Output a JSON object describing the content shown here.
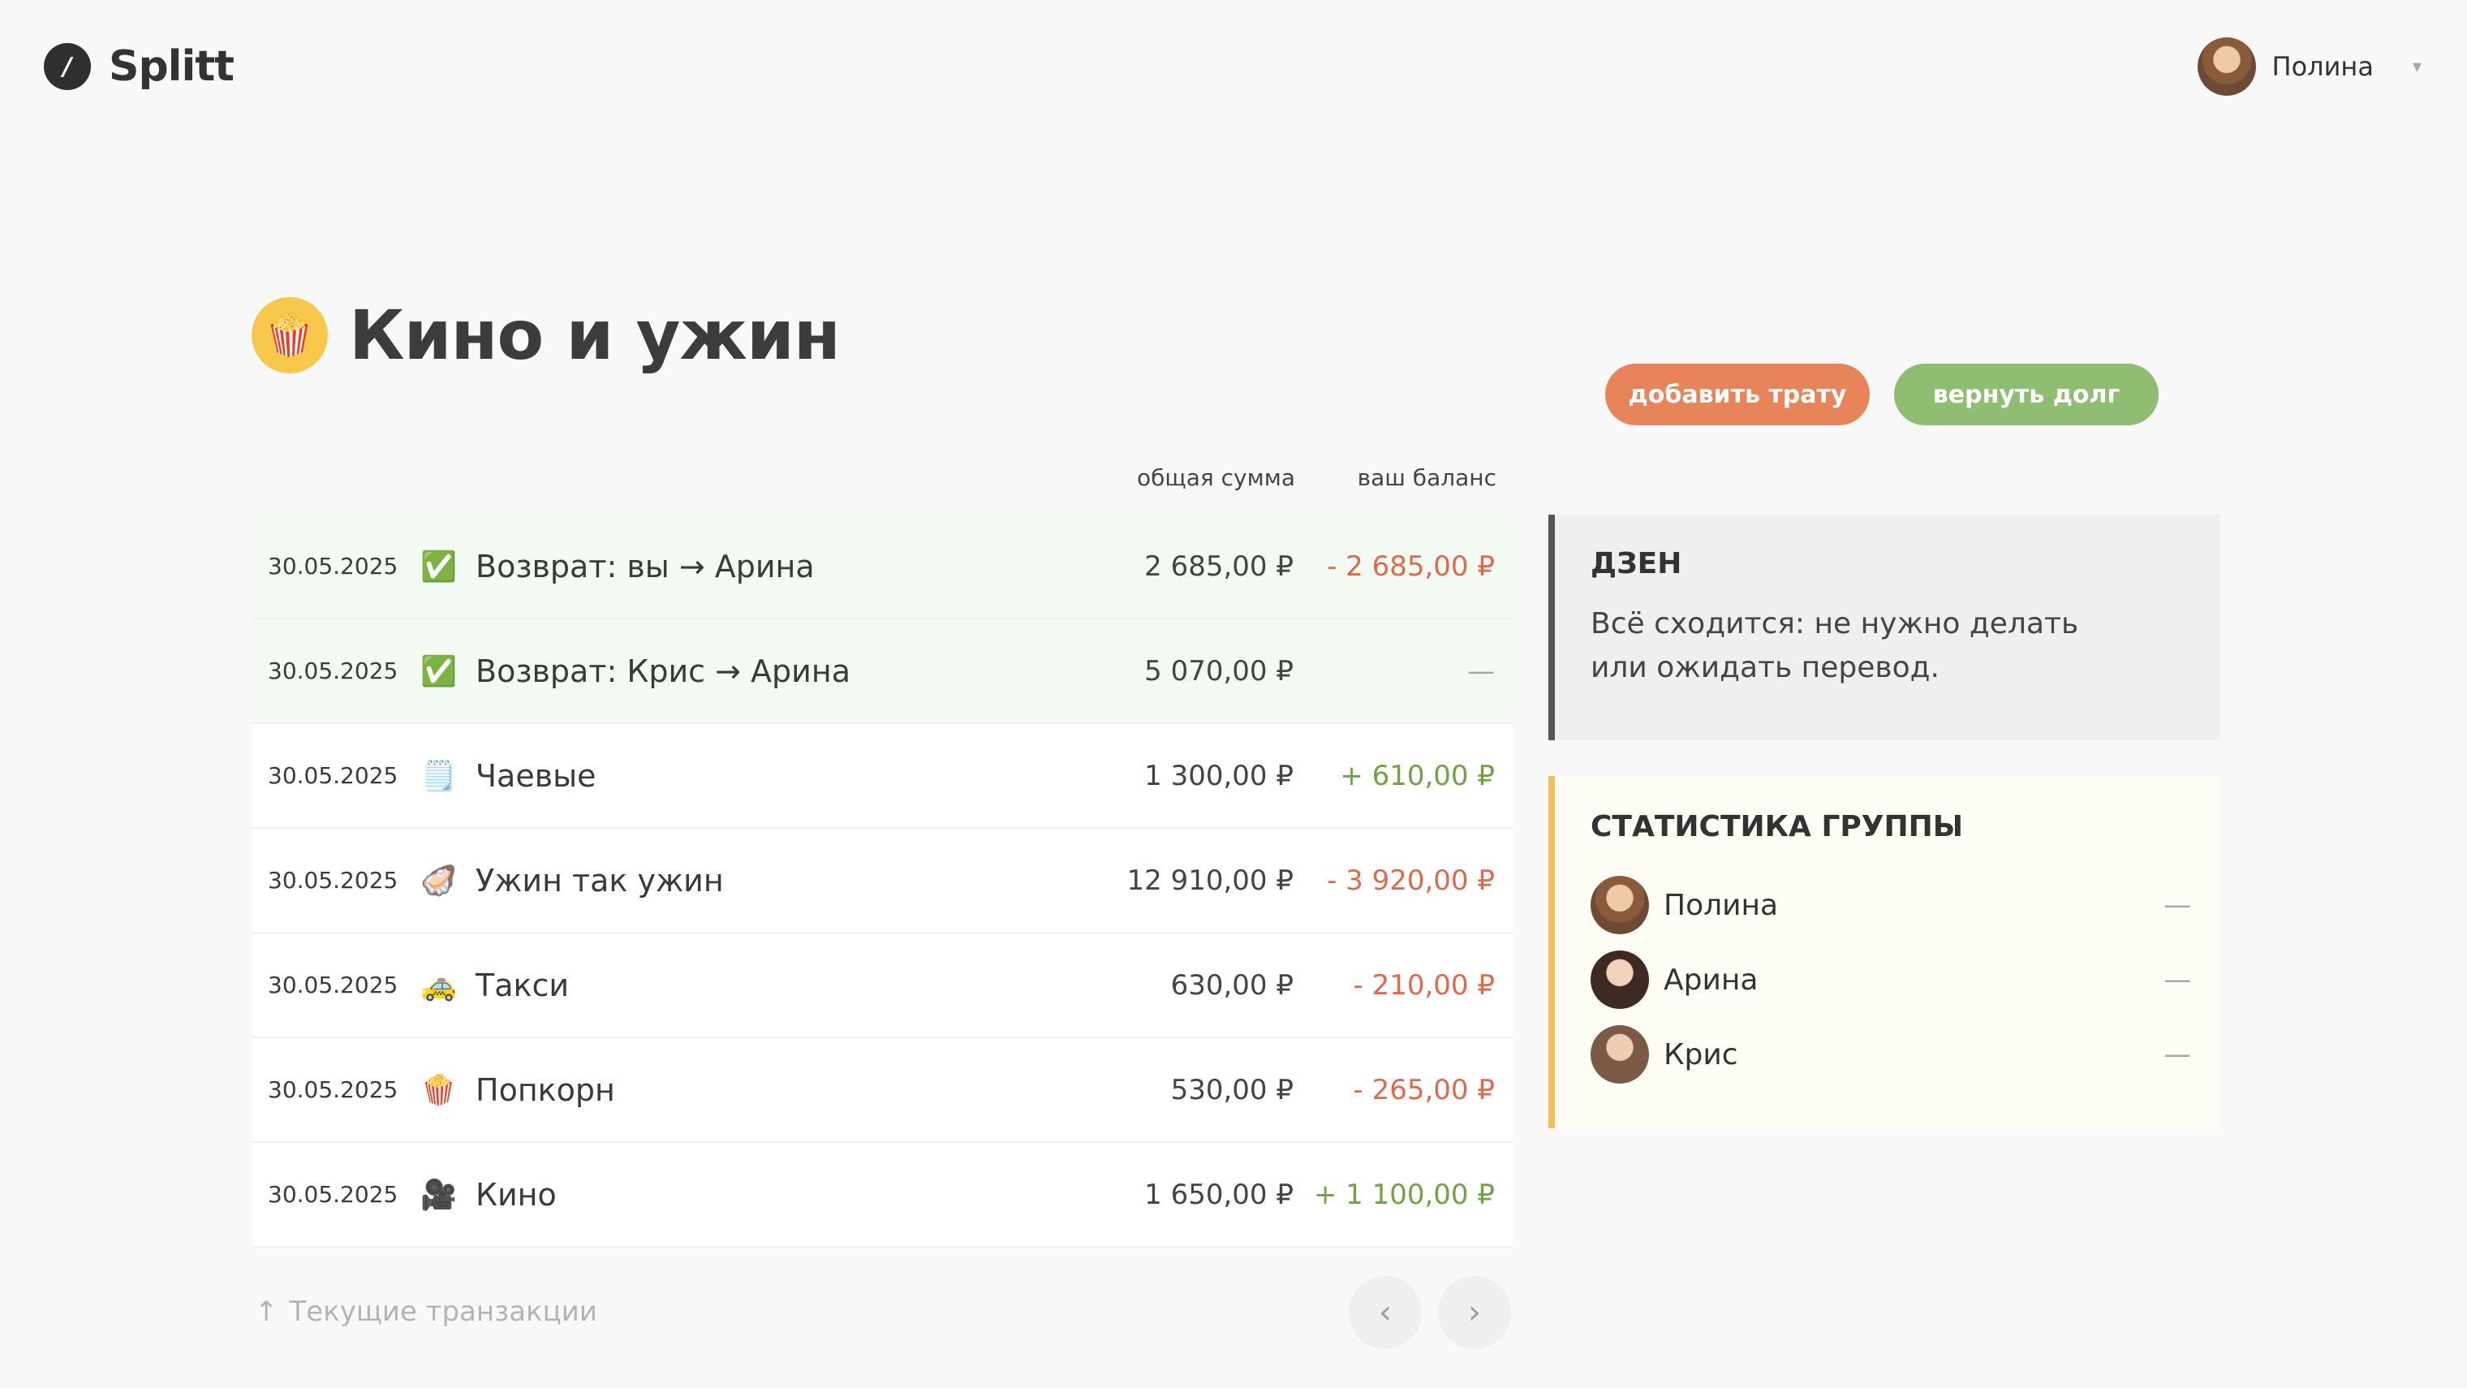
{
  "app": {
    "logo_mark": "/",
    "name": "Splitt"
  },
  "user": {
    "name": "Полина",
    "caret": "▾"
  },
  "group": {
    "icon": "🍿",
    "title": "Кино и ужин"
  },
  "actions": {
    "add_expense": "добавить трату",
    "repay": "вернуть долг"
  },
  "table": {
    "headers": {
      "total": "общая сумма",
      "balance": "ваш баланс"
    },
    "rows": [
      {
        "date": "30.05.2025",
        "icon": "✅",
        "name": "Возврат: вы → Арина",
        "amount": "2 685,00 ₽",
        "balance": "- 2 685,00 ₽",
        "kind": "neg",
        "settled": true
      },
      {
        "date": "30.05.2025",
        "icon": "✅",
        "name": "Возврат: Крис → Арина",
        "amount": "5 070,00 ₽",
        "balance": "—",
        "kind": "zero",
        "settled": true
      },
      {
        "date": "30.05.2025",
        "icon": "🗒️",
        "name": "Чаевые",
        "amount": "1 300,00 ₽",
        "balance": "+ 610,00 ₽",
        "kind": "pos",
        "settled": false
      },
      {
        "date": "30.05.2025",
        "icon": "🦪",
        "name": "Ужин так ужин",
        "amount": "12 910,00 ₽",
        "balance": "- 3 920,00 ₽",
        "kind": "neg",
        "settled": false
      },
      {
        "date": "30.05.2025",
        "icon": "🚕",
        "name": "Такси",
        "amount": "630,00 ₽",
        "balance": "- 210,00 ₽",
        "kind": "neg",
        "settled": false
      },
      {
        "date": "30.05.2025",
        "icon": "🍿",
        "name": "Попкорн",
        "amount": "530,00 ₽",
        "balance": "- 265,00 ₽",
        "kind": "neg",
        "settled": false
      },
      {
        "date": "30.05.2025",
        "icon": "🎥",
        "name": "Кино",
        "amount": "1 650,00 ₽",
        "balance": "+ 1 100,00 ₽",
        "kind": "pos",
        "settled": false
      }
    ]
  },
  "footer": {
    "arrow": "↑",
    "current_label": "Текущие транзакции",
    "prev": "‹",
    "next": "›"
  },
  "zen": {
    "heading": "ДЗЕН",
    "text": "Всё сходится: не нужно делать или ожидать перевод."
  },
  "stats": {
    "heading": "СТАТИСТИКА ГРУППЫ",
    "members": [
      {
        "name": "Полина",
        "balance": "—"
      },
      {
        "name": "Арина",
        "balance": "—"
      },
      {
        "name": "Крис",
        "balance": "—"
      }
    ]
  },
  "colors": {
    "accent_orange": "#e8845a",
    "accent_green": "#8fbe73",
    "negative": "#dd6a4e",
    "positive": "#6fa346",
    "stats_border": "#f0c05a"
  }
}
